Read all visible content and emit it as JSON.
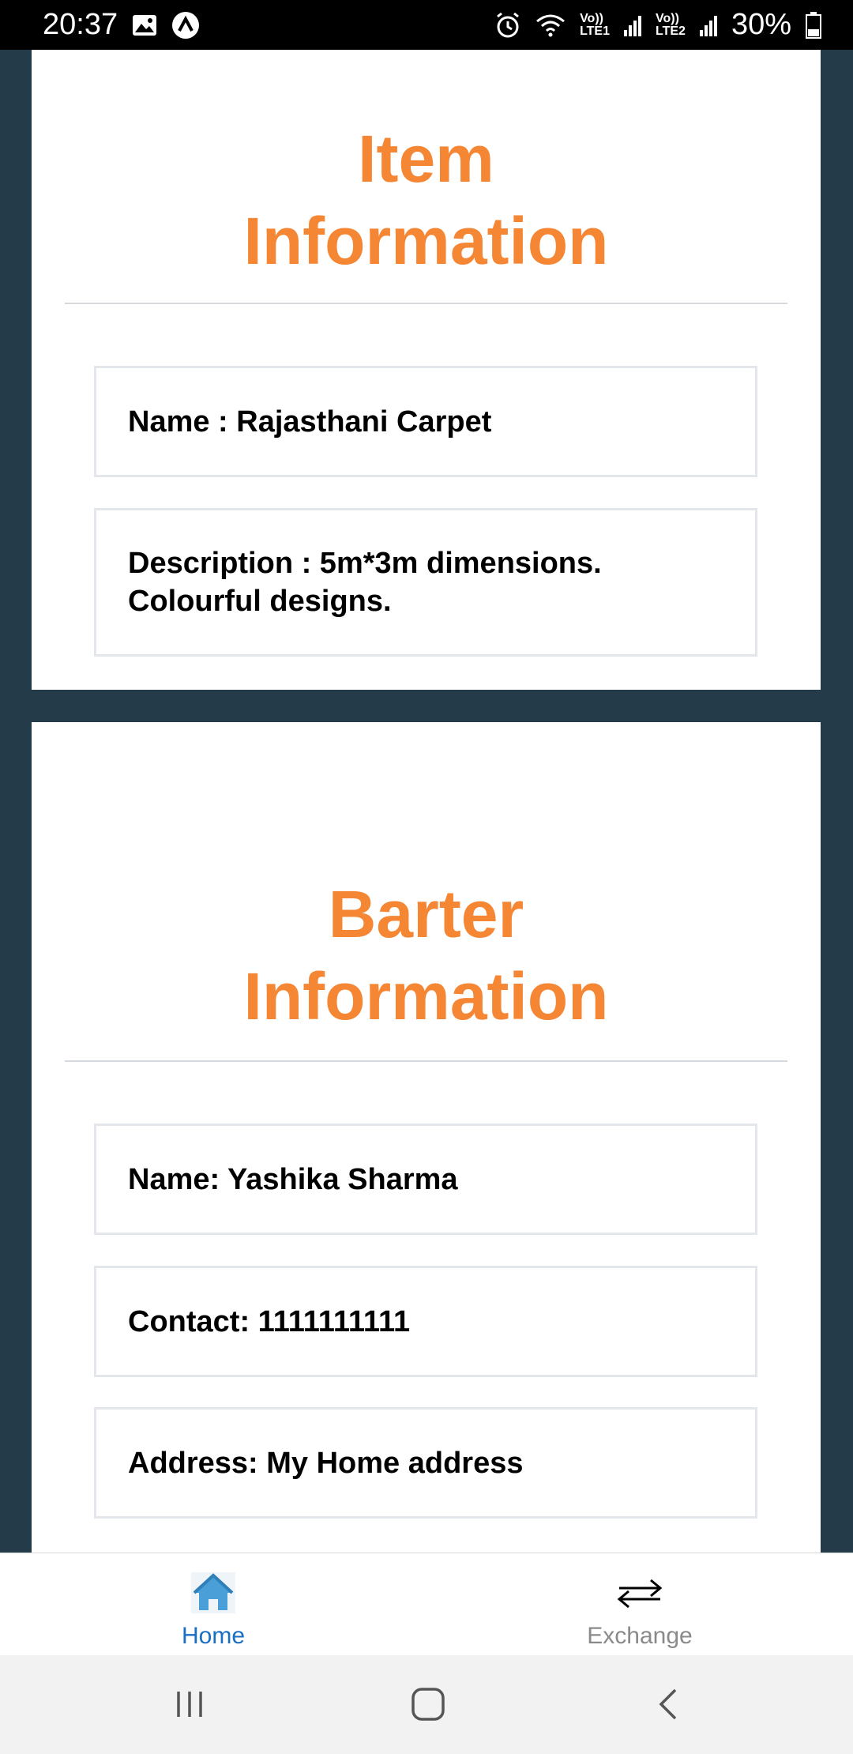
{
  "status_bar": {
    "time": "20:37",
    "sim1_label_top": "Vo))",
    "sim1_label_bottom": "LTE1",
    "sim2_label_top": "Vo))",
    "sim2_label_bottom": "LTE2",
    "battery": "30%",
    "icons": [
      "image-icon",
      "app-a-icon",
      "alarm-icon",
      "wifi-icon",
      "signal-icon",
      "battery-icon"
    ]
  },
  "item_card": {
    "title_line1": "Item",
    "title_line2": "Information",
    "name": "Name : Rajasthani Carpet",
    "description": "Description : 5m*3m dimensions. Colourful designs."
  },
  "barter_card": {
    "title_line1": "Barter",
    "title_line2": "Information",
    "name": "Name: Yashika  Sharma",
    "contact": "Contact: 1111111111",
    "address": "Address: My Home address"
  },
  "tabs": [
    {
      "label": "Home",
      "icon": "home-icon",
      "active": true
    },
    {
      "label": "Exchange",
      "icon": "exchange-arrows-icon",
      "active": false
    }
  ],
  "colors": {
    "accent": "#f58634",
    "background": "#243b4a",
    "active_tab": "#1a6fc4",
    "inactive_tab": "#8a8a8a"
  }
}
